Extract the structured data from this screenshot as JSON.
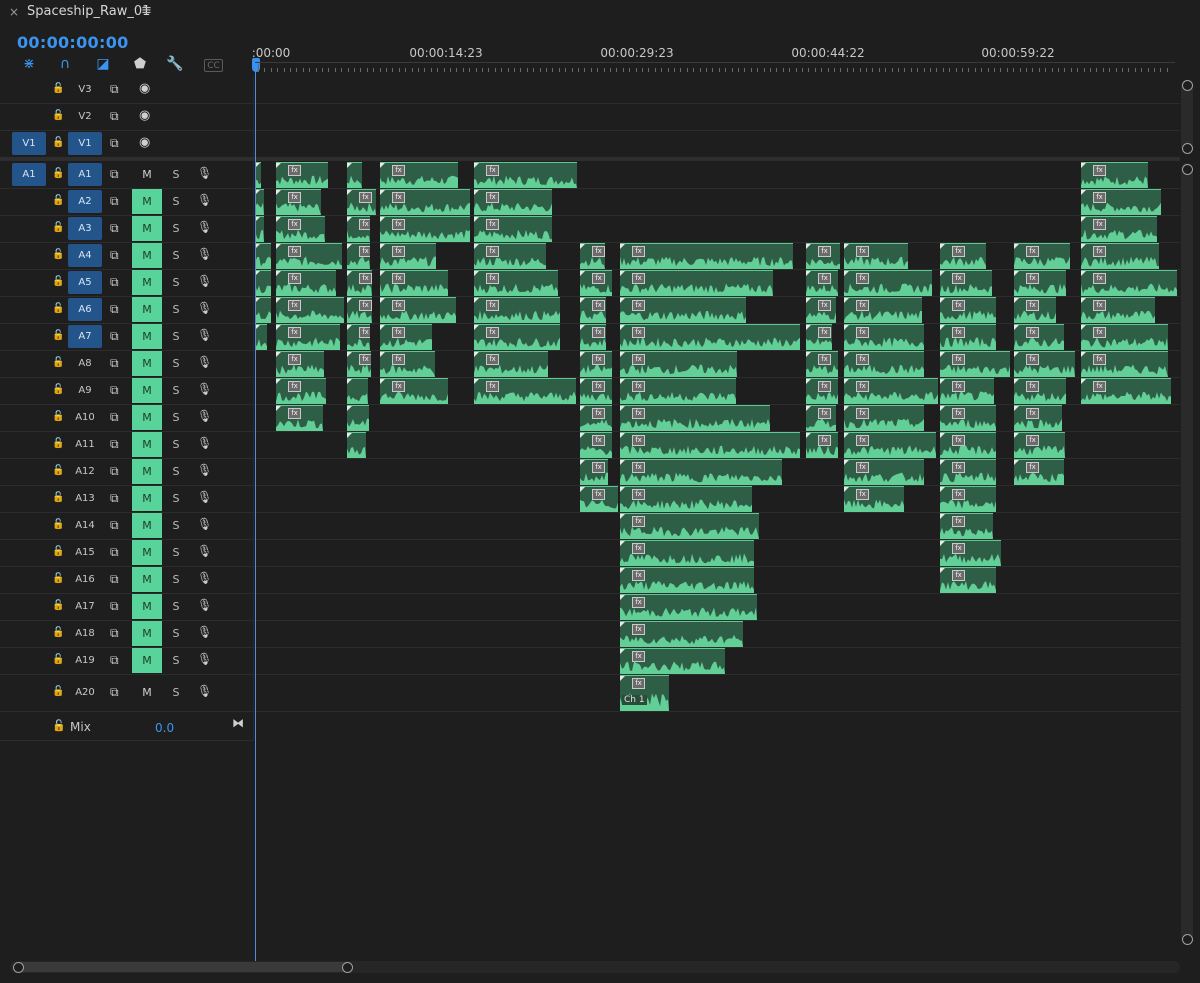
{
  "panel": {
    "close_glyph": "×",
    "title": "Spaceship_Raw_01",
    "menu_glyph": "≡"
  },
  "timecode": "00:00:00:00",
  "toolbar": [
    {
      "name": "nest-sequence-icon",
      "glyph": "⋇",
      "color": "#3b95f0"
    },
    {
      "name": "snap-magnet-icon",
      "glyph": "∩",
      "color": "#3b95f0"
    },
    {
      "name": "linked-selection-icon",
      "glyph": "◪",
      "color": "#3b95f0"
    },
    {
      "name": "add-marker-icon",
      "glyph": "⬟",
      "color": "#cfcfcf"
    },
    {
      "name": "wrench-settings-icon",
      "glyph": "🔧",
      "color": "#cfcfcf"
    },
    {
      "name": "captions-icon",
      "glyph": "CC",
      "color": "#6a6a6a"
    }
  ],
  "ruler_labels": [
    ":00:00",
    "00:00:14:23",
    "00:00:29:23",
    "00:00:44:22",
    "00:00:59:22"
  ],
  "video_tracks": [
    {
      "name": "V3",
      "source_target": "",
      "visible": true
    },
    {
      "name": "V2",
      "source_target": "",
      "visible": true
    },
    {
      "name": "V1",
      "source_target": "V1",
      "visible": true
    }
  ],
  "audio_tracks": [
    {
      "name": "A1",
      "source_target": "A1",
      "target_on": true,
      "mute_on": false
    },
    {
      "name": "A2",
      "source_target": "",
      "target_on": true,
      "mute_on": true
    },
    {
      "name": "A3",
      "source_target": "",
      "target_on": true,
      "mute_on": true
    },
    {
      "name": "A4",
      "source_target": "",
      "target_on": true,
      "mute_on": true
    },
    {
      "name": "A5",
      "source_target": "",
      "target_on": true,
      "mute_on": true
    },
    {
      "name": "A6",
      "source_target": "",
      "target_on": true,
      "mute_on": true
    },
    {
      "name": "A7",
      "source_target": "",
      "target_on": true,
      "mute_on": true
    },
    {
      "name": "A8",
      "source_target": "",
      "target_on": false,
      "mute_on": true
    },
    {
      "name": "A9",
      "source_target": "",
      "target_on": false,
      "mute_on": true
    },
    {
      "name": "A10",
      "source_target": "",
      "target_on": false,
      "mute_on": true
    },
    {
      "name": "A11",
      "source_target": "",
      "target_on": false,
      "mute_on": true
    },
    {
      "name": "A12",
      "source_target": "",
      "target_on": false,
      "mute_on": true
    },
    {
      "name": "A13",
      "source_target": "",
      "target_on": false,
      "mute_on": true
    },
    {
      "name": "A14",
      "source_target": "",
      "target_on": false,
      "mute_on": true
    },
    {
      "name": "A15",
      "source_target": "",
      "target_on": false,
      "mute_on": true
    },
    {
      "name": "A16",
      "source_target": "",
      "target_on": false,
      "mute_on": true
    },
    {
      "name": "A17",
      "source_target": "",
      "target_on": false,
      "mute_on": true
    },
    {
      "name": "A18",
      "source_target": "",
      "target_on": false,
      "mute_on": true
    },
    {
      "name": "A19",
      "source_target": "",
      "target_on": false,
      "mute_on": true
    },
    {
      "name": "A20",
      "source_target": "",
      "target_on": false,
      "mute_on": false
    }
  ],
  "button_labels": {
    "mute": "M",
    "solo": "S"
  },
  "mix": {
    "label": "Mix",
    "value": "0.0"
  },
  "clip_fx_label": "fx",
  "clip_channel_label": "Ch 1",
  "colors": {
    "accent_blue": "#3b95f0",
    "target_blue": "#23558b",
    "mute_green": "#58d39a",
    "clip_green": "#2f5e47",
    "waveform_green": "#62cf96"
  },
  "icons": {
    "lock": "🔓",
    "film": "⧉",
    "eye": "◉",
    "mic": "🎙",
    "mix_end": "⧓"
  }
}
